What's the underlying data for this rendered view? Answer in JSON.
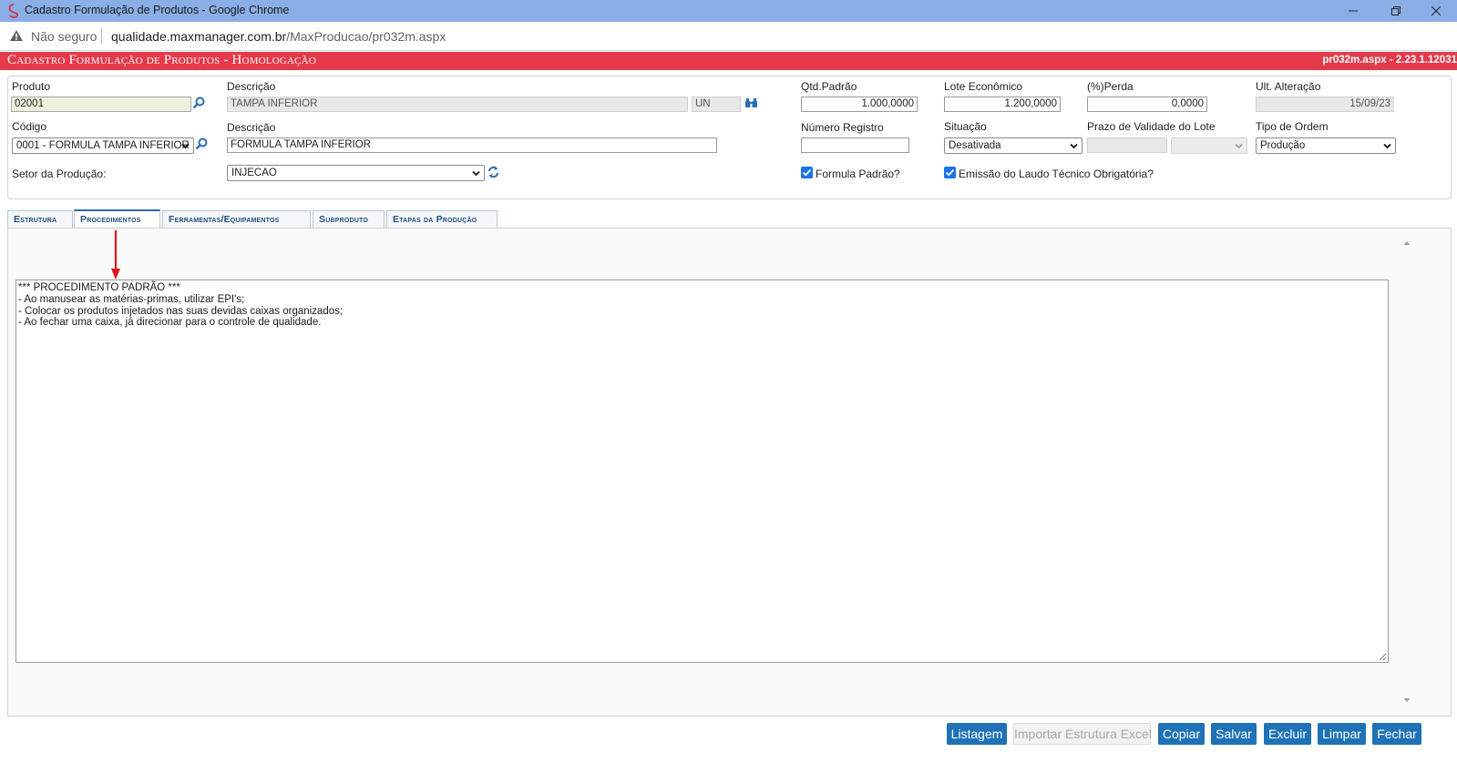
{
  "window": {
    "title": "Cadastro Formulação de Produtos - Google Chrome",
    "not_secure": "Não seguro",
    "url_host": "qualidade.maxmanager.com.br",
    "url_path": "/MaxProducao/pr032m.aspx"
  },
  "header": {
    "title": "Cadastro Formulação de Produtos  - Homologação",
    "version": "pr032m.aspx - 2.23.1.12031",
    "color": "#e43a4a"
  },
  "form": {
    "produto_label": "Produto",
    "produto_value": "02001",
    "descricao_label": "Descrição",
    "descricao_value": "TAMPA INFERIOR",
    "unidade_value": "UN",
    "qtd_padrao_label": "Qtd.Padrão",
    "qtd_padrao_value": "1.000,0000",
    "lote_label": "Lote Econômico",
    "lote_value": "1.200,0000",
    "perda_label": "(%)Perda",
    "perda_value": "0,0000",
    "ult_alteracao_label": "Ult. Alteração",
    "ult_alteracao_value": "15/09/23",
    "codigo_label": "Código",
    "codigo_value": "0001 - FORMULA TAMPA INFERIOR",
    "descricao2_label": "Descrição",
    "descricao2_value": "FORMULA TAMPA INFERIOR",
    "numero_registro_label": "Número Registro",
    "numero_registro_value": "",
    "situacao_label": "Situação",
    "situacao_value": "Desativada",
    "prazo_label": "Prazo de Validade do Lote",
    "tipo_ordem_label": "Tipo de Ordem",
    "tipo_ordem_value": "Produção",
    "setor_label": "Setor da Produção:",
    "setor_value": "INJECAO",
    "formula_padrao_label": "Formula Padrão?",
    "formula_padrao_checked": true,
    "laudo_label": "Emissão do Laudo Técnico Obrigatória?",
    "laudo_checked": true
  },
  "tabs": [
    {
      "label": "Estrutura"
    },
    {
      "label": "Procedimentos"
    },
    {
      "label": "Ferramentas/Equipamentos"
    },
    {
      "label": "Subproduto"
    },
    {
      "label": "Etapas da Produção"
    }
  ],
  "procedimentos": {
    "lines": [
      "*** PROCEDIMENTO PADRÃO ***",
      "- Ao manusear as matérias-primas, utilizar EPI's;",
      "- Colocar os produtos injetados nas suas devidas caixas organizados;",
      "- Ao fechar uma caixa, já direcionar para o controle de qualidade."
    ]
  },
  "buttons": {
    "listagem": "Listagem",
    "importar": "Importar Estrutura Excel",
    "copiar": "Copiar",
    "salvar": "Salvar",
    "excluir": "Excluir",
    "limpar": "Limpar",
    "fechar": "Fechar"
  }
}
